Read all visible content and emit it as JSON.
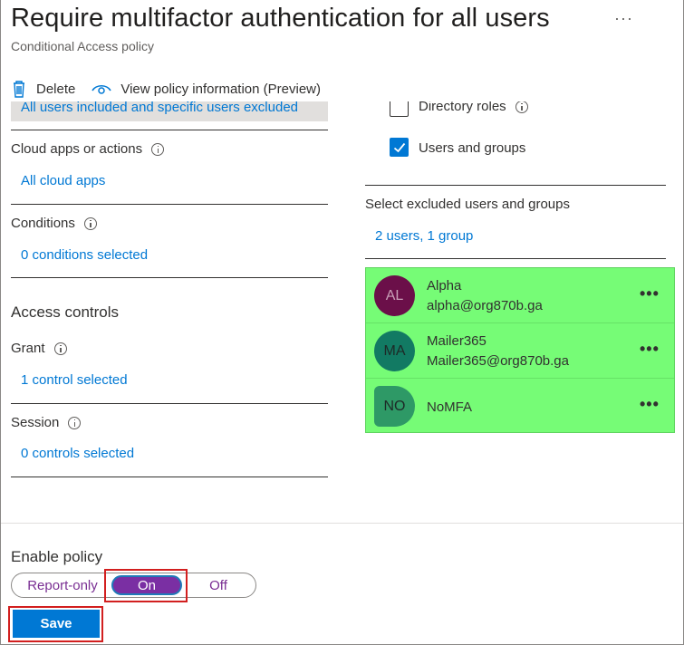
{
  "header": {
    "title": "Require multifactor authentication for all users",
    "subtitle": "Conditional Access policy",
    "more": "···"
  },
  "toolbar": {
    "delete_label": "Delete",
    "view_info_label": "View policy information (Preview)"
  },
  "left": {
    "users_summary": "All users included and specific users excluded",
    "cloud_apps_label": "Cloud apps or actions",
    "cloud_apps_value": "All cloud apps",
    "conditions_label": "Conditions",
    "conditions_value": "0 conditions selected",
    "access_controls_heading": "Access controls",
    "grant_label": "Grant",
    "grant_value": "1 control selected",
    "session_label": "Session",
    "session_value": "0 controls selected"
  },
  "right": {
    "directory_roles_label": "Directory roles",
    "users_groups_label": "Users and groups",
    "users_groups_checked": true,
    "excluded_label": "Select excluded users and groups",
    "excluded_value": "2 users, 1 group",
    "users": [
      {
        "initials": "AL",
        "name": "Alpha",
        "email": "alpha@org870b.ga",
        "color": "#6b0f49",
        "text": "#c9a0b8"
      },
      {
        "initials": "MA",
        "name": "Mailer365",
        "email": "Mailer365@org870b.ga",
        "color": "#127a63",
        "text": "#1d2a27"
      },
      {
        "initials": "NO",
        "name": "NoMFA",
        "email": "",
        "color": "#2e9966",
        "text": "#1d2a27"
      }
    ],
    "row_more": "•••"
  },
  "footer": {
    "enable_label": "Enable policy",
    "options": [
      "Report-only",
      "On",
      "Off"
    ],
    "selected": "On",
    "save_label": "Save"
  },
  "colors": {
    "accent": "#0078d4",
    "toggle_on": "#7a2fa3",
    "highlight_green": "#76fc76",
    "annotation_red": "#d21f1f"
  }
}
